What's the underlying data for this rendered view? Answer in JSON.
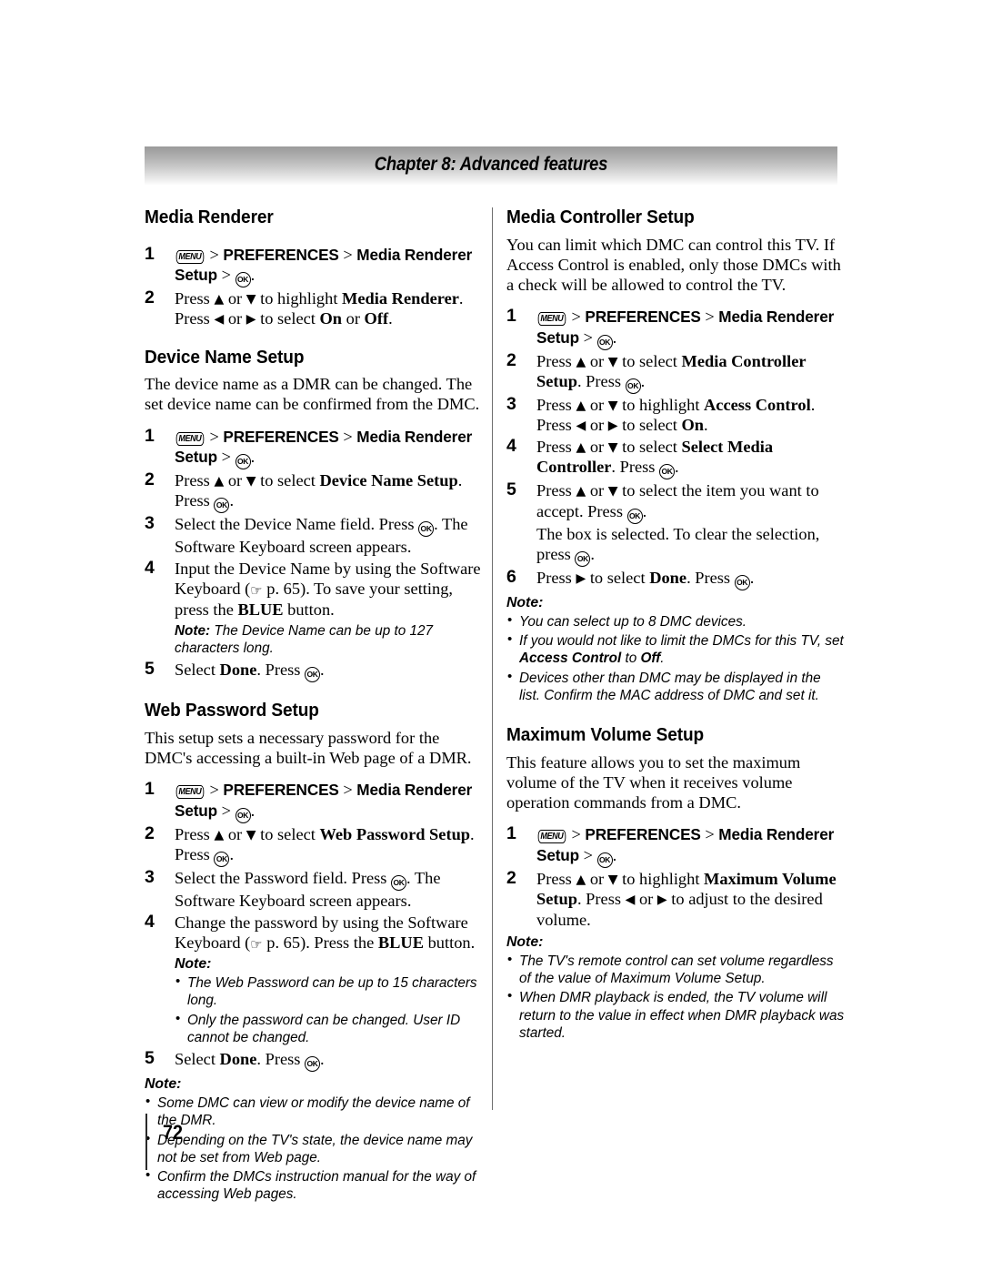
{
  "header": {
    "chapter_title": "Chapter 8: Advanced features"
  },
  "icons": {
    "menu": "MENU",
    "ok": "OK",
    "hand": "☞",
    "up": "▲",
    "down": "▼",
    "left": "◀",
    "right": "▶"
  },
  "footer": {
    "page_number": "72"
  },
  "left_column": {
    "sections": [
      {
        "heading": "Media Renderer",
        "steps": [
          {
            "num": "1",
            "text_html": "ICON_MENU > <b class=\"bold-sans\">PREFERENCES</b> > <b class=\"bold-sans\">Media Renderer Setup</b> > ICON_OK."
          },
          {
            "num": "2",
            "text_html": "Press ICON_UP or ICON_DOWN to highlight <b>Media Renderer</b>. Press ICON_LEFT or ICON_RIGHT to select <b>On</b> or <b>Off</b>."
          }
        ]
      },
      {
        "heading": "Device Name Setup",
        "intro": "The device name as a DMR can be changed. The set device name can be confirmed from the DMC.",
        "steps": [
          {
            "num": "1",
            "text_html": "ICON_MENU > <b class=\"bold-sans\">PREFERENCES</b> > <b class=\"bold-sans\">Media Renderer Setup</b> > ICON_OK."
          },
          {
            "num": "2",
            "text_html": "Press ICON_UP or ICON_DOWN to select <b>Device Name Setup</b>. Press ICON_OK."
          },
          {
            "num": "3",
            "text_html": "Select the Device Name field. Press ICON_OK. The Software Keyboard screen appears."
          },
          {
            "num": "4",
            "text_html": "Input the Device Name by using the Software Keyboard (ICON_HAND p. 65). To save your setting, press the <b>BLUE</b> button.",
            "note_html": "<span class=\"note-inline-label\">Note:</span> The Device Name can be up to 127 characters long."
          },
          {
            "num": "5",
            "text_html": "Select <b>Done</b>. Press ICON_OK."
          }
        ]
      },
      {
        "heading": "Web Password Setup",
        "intro": "This setup sets a necessary password for the DMC's accessing a built-in Web page of a DMR.",
        "steps": [
          {
            "num": "1",
            "text_html": "ICON_MENU > <b class=\"bold-sans\">PREFERENCES</b> > <b class=\"bold-sans\">Media Renderer Setup</b> > ICON_OK."
          },
          {
            "num": "2",
            "text_html": "Press ICON_UP or ICON_DOWN to select <b>Web Password Setup</b>. Press ICON_OK."
          },
          {
            "num": "3",
            "text_html": "Select the Password field. Press ICON_OK. The Software Keyboard screen appears."
          },
          {
            "num": "4",
            "text_html": "Change the password by using the Software Keyboard (ICON_HAND p. 65). Press the <b>BLUE</b> button.",
            "note_label": "Note:",
            "note_bullets": [
              "The Web Password can be up to 15 characters long.",
              "Only the password can be changed. User ID cannot be changed."
            ]
          },
          {
            "num": "5",
            "text_html": "Select <b>Done</b>. Press ICON_OK."
          }
        ],
        "trailing_note": {
          "label": "Note:",
          "bullets": [
            "Some DMC can view or modify the device name of the DMR.",
            "Depending on the TV's state, the device name may not be set from Web page.",
            "Confirm the DMCs instruction manual for the way of accessing Web pages."
          ]
        }
      }
    ]
  },
  "right_column": {
    "sections": [
      {
        "heading": "Media Controller Setup",
        "intro": "You can limit which DMC can control this TV. If Access Control is enabled, only those DMCs with a check will be allowed to control the TV.",
        "steps": [
          {
            "num": "1",
            "text_html": "ICON_MENU > <b class=\"bold-sans\">PREFERENCES</b> > <b class=\"bold-sans\">Media Renderer Setup</b> > ICON_OK."
          },
          {
            "num": "2",
            "text_html": "Press ICON_UP or ICON_DOWN to select <b>Media Controller Setup</b>. Press ICON_OK."
          },
          {
            "num": "3",
            "text_html": "Press ICON_UP or ICON_DOWN to highlight <b>Access Control</b>. Press ICON_LEFT or ICON_RIGHT to select <b>On</b>."
          },
          {
            "num": "4",
            "text_html": "Press ICON_UP or ICON_DOWN to select <b>Select Media Controller</b>. Press ICON_OK."
          },
          {
            "num": "5",
            "text_html": "Press ICON_UP or ICON_DOWN to select the item you want to accept. Press ICON_OK.<br>The box is selected. To clear the selection, press ICON_OK."
          },
          {
            "num": "6",
            "text_html": "Press ICON_RIGHT to select <b>Done</b>. Press ICON_OK."
          }
        ],
        "trailing_note": {
          "label": "Note:",
          "bullets": [
            "You can select up to 8 DMC devices.",
            "If you would not like to limit the DMCs for this TV, set <b>Access Control</b> to <b>Off</b>.",
            "Devices other than DMC may be displayed in the list. Confirm the MAC address of DMC and set it."
          ]
        }
      },
      {
        "heading": "Maximum Volume Setup",
        "intro": "This feature allows you to set the maximum volume of the TV when it receives volume operation commands from a DMC.",
        "steps": [
          {
            "num": "1",
            "text_html": "ICON_MENU > <b class=\"bold-sans\">PREFERENCES</b> > <b class=\"bold-sans\">Media Renderer Setup</b> > ICON_OK."
          },
          {
            "num": "2",
            "text_html": "Press ICON_UP or ICON_DOWN to highlight <b>Maximum Volume Setup</b>. Press ICON_LEFT or ICON_RIGHT to adjust to the desired volume."
          }
        ],
        "trailing_note": {
          "label": "Note:",
          "bullets": [
            "The TV's remote control can set volume regardless of the value of Maximum Volume Setup.",
            "When DMR playback is ended, the TV volume will return to the value in effect when DMR playback was started."
          ]
        }
      }
    ]
  }
}
